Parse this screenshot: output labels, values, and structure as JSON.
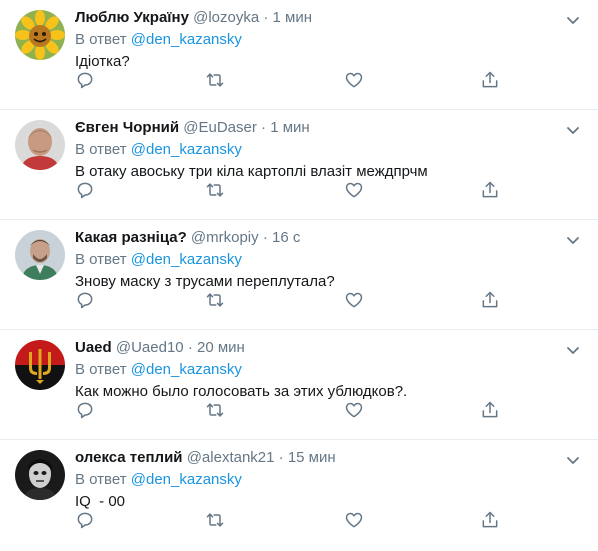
{
  "tweets": [
    {
      "name": "Люблю Україну",
      "handle": "@lozoyka",
      "dot": "·",
      "time": "1 мин",
      "reply_prefix": "В ответ ",
      "reply_to": "@den_kazansky",
      "text": "Ідіотка?",
      "avatar": "sunflower-avatar"
    },
    {
      "name": "Євген Чорний",
      "handle": "@EuDaser",
      "dot": "·",
      "time": "1 мин",
      "reply_prefix": "В ответ ",
      "reply_to": "@den_kazansky",
      "text": "В отаку авоську три кіла картоплі влазіт междпрчм",
      "avatar": "man-photo-avatar"
    },
    {
      "name": "Какая разніца?",
      "handle": "@mrkopiy",
      "dot": "·",
      "time": "16 с",
      "reply_prefix": "В ответ ",
      "reply_to": "@den_kazansky",
      "text": "Знову маску з трусами переплутала?",
      "avatar": "man-photo-avatar"
    },
    {
      "name": "Uaed",
      "handle": "@Uaed10",
      "dot": "·",
      "time": "20 мин",
      "reply_prefix": "В ответ ",
      "reply_to": "@den_kazansky",
      "text": "Как можно было голосовать за этих ублюдков?.",
      "avatar": "trident-flag-avatar"
    },
    {
      "name": "олекса теплий",
      "handle": "@alextank21",
      "dot": "·",
      "time": "15 мин",
      "reply_prefix": "В ответ ",
      "reply_to": "@den_kazansky",
      "text": "IQ  - 00",
      "avatar": "dark-face-avatar"
    }
  ],
  "colors": {
    "link": "#1b95e0",
    "muted": "#657786",
    "text": "#14171a",
    "divider": "#e6ecf0"
  },
  "icons": {
    "menu": "chevron-down-icon",
    "reply": "reply-icon",
    "retweet": "retweet-icon",
    "like": "like-icon",
    "share": "share-icon"
  }
}
